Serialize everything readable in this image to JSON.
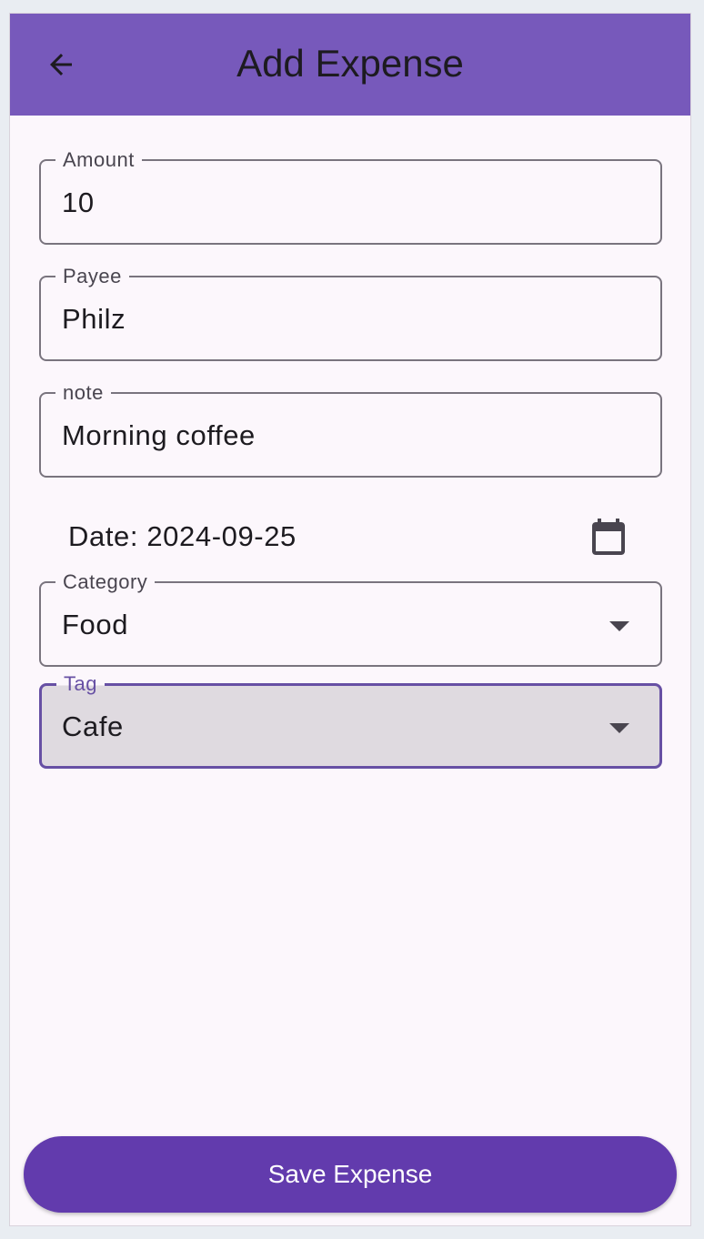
{
  "appbar": {
    "title": "Add Expense",
    "back_icon": "arrow-back-icon"
  },
  "form": {
    "amount": {
      "label": "Amount",
      "value": "10"
    },
    "payee": {
      "label": "Payee",
      "value": "Philz"
    },
    "note": {
      "label": "note",
      "value": "Morning coffee"
    },
    "date": {
      "prefix": "Date:",
      "value": "2024-09-25",
      "icon": "calendar-icon"
    },
    "category": {
      "label": "Category",
      "value": "Food",
      "icon": "dropdown-arrow-icon"
    },
    "tag": {
      "label": "Tag",
      "value": "Cafe",
      "icon": "dropdown-arrow-icon",
      "focused": true
    }
  },
  "actions": {
    "save_label": "Save Expense"
  },
  "colors": {
    "primary": "#6750a4",
    "appbar": "#7759bb",
    "button": "#623bad",
    "surface": "#fcf7fc",
    "outline": "#79747e"
  }
}
